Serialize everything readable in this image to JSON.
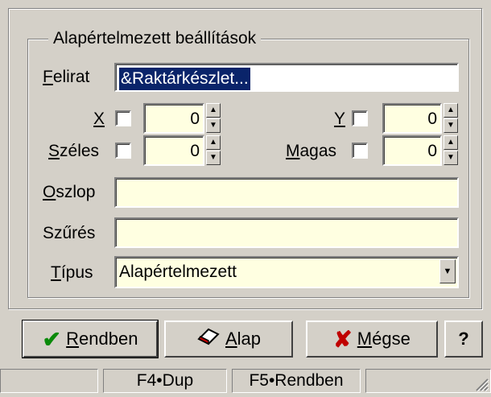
{
  "group_legend": "Alapértelmezett beállítások",
  "felirat": {
    "label_u": "F",
    "label_rest": "elirat",
    "value": "&Raktárkészlet..."
  },
  "x": {
    "label_u": "X",
    "value": "0"
  },
  "y": {
    "label_u": "Y",
    "value": "0"
  },
  "szeles": {
    "label_u": "S",
    "label_rest": "zéles",
    "value": "0"
  },
  "magas": {
    "label_u": "M",
    "label_rest": "agas",
    "value": "0"
  },
  "oszlop": {
    "label_u": "O",
    "label_rest": "szlop",
    "value": ""
  },
  "szures": {
    "label_pre": "Sző",
    "label_u": "ű",
    "label_rest": "rés",
    "label_full": "Szűrés",
    "value": ""
  },
  "tipus": {
    "label_u": "T",
    "label_rest": "ípus",
    "value": "Alapértelmezett"
  },
  "buttons": {
    "ok": {
      "u": "R",
      "rest": "endben"
    },
    "alap": {
      "u": "A",
      "rest": "lap"
    },
    "megse": {
      "u": "M",
      "rest": "égse"
    },
    "help": "?"
  },
  "status": {
    "f4": "F4•Dup",
    "f5": "F5•Rendben"
  },
  "icons": [
    "checkmark-icon",
    "eraser-icon",
    "x-cross-icon",
    "spin-up-icon",
    "spin-down-icon",
    "dropdown-arrow-icon",
    "resize-grip-icon"
  ]
}
